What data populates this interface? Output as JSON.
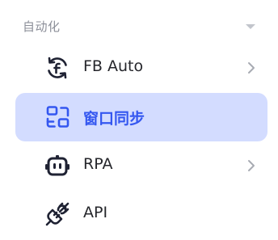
{
  "group": {
    "title": "自动化",
    "caret_icon": "caret-down-icon"
  },
  "items": [
    {
      "label": "FB Auto",
      "icon": "facebook-sync-icon",
      "has_submenu": true,
      "active": false
    },
    {
      "label": "窗口同步",
      "icon": "window-sync-icon",
      "has_submenu": false,
      "active": true
    },
    {
      "label": "RPA",
      "icon": "robot-icon",
      "has_submenu": true,
      "active": false
    },
    {
      "label": "API",
      "icon": "plug-connector-icon",
      "has_submenu": false,
      "active": false
    }
  ],
  "colors": {
    "active_background": "#d3dcff",
    "active_text": "#3457f0",
    "text": "#25262b",
    "muted": "#8c8f99"
  }
}
